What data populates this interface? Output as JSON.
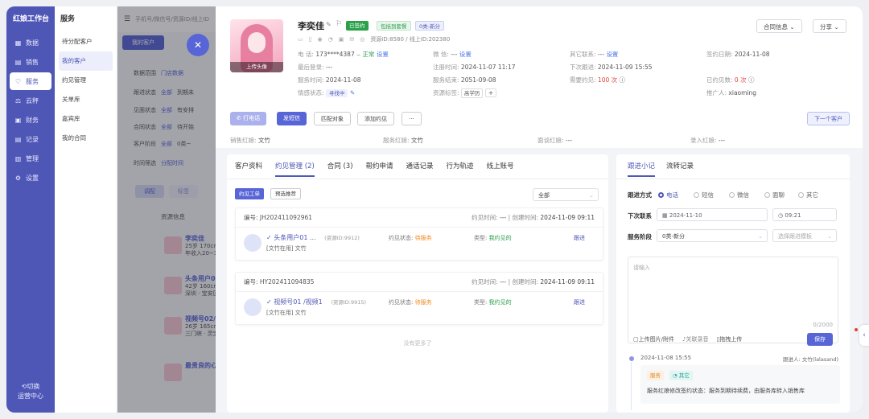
{
  "sidebar": {
    "brand": "红娘工作台",
    "items": [
      {
        "label": "数据",
        "icon": "grid-icon"
      },
      {
        "label": "销售",
        "icon": "chart-icon"
      },
      {
        "label": "服务",
        "icon": "heart-icon"
      },
      {
        "label": "云秤",
        "icon": "scale-icon"
      },
      {
        "label": "财务",
        "icon": "finance-icon"
      },
      {
        "label": "记录",
        "icon": "record-icon"
      },
      {
        "label": "管理",
        "icon": "manage-icon"
      },
      {
        "label": "设置",
        "icon": "gear-icon"
      }
    ],
    "active_index": 2,
    "switch_label": "切换",
    "ops_label": "运营中心"
  },
  "subnav": {
    "title": "服务",
    "items": [
      "待分配客户",
      "我的客户",
      "约见管理",
      "关单库",
      "嘉宾库",
      "我的合同"
    ],
    "active_index": 1
  },
  "background": {
    "search_placeholder": "手机号/微信号/资源ID/线上ID",
    "tab": "我的客户",
    "filter_rows": [
      {
        "label": "数据范围",
        "value": "门店数据"
      },
      {
        "label": "跟进状态",
        "value": "全部",
        "extra": "到期未"
      },
      {
        "label": "见面状态",
        "value": "全部",
        "extra": "有安排"
      },
      {
        "label": "合同状态",
        "value": "全部",
        "extra": "待开始"
      },
      {
        "label": "客户阶段",
        "value": "全部",
        "extra": "0类~"
      },
      {
        "label": "时间筛选",
        "value": "分配时间"
      }
    ],
    "btn_assign": "调配",
    "btn_mark": "标签",
    "list_header": "资源信息",
    "cards": [
      {
        "name": "李奕佳",
        "line1": "25岁 170cm",
        "line2": "年收入20~30万"
      },
      {
        "name": "头条用户03",
        "line1": "42岁 160cm",
        "line2": "深圳 · 宝安区"
      },
      {
        "name": "视频号02/视",
        "line1": "26岁 165cm",
        "line2": "三门峡 · 灵宝"
      },
      {
        "name": "最贵良的心",
        "line1": "",
        "line2": ""
      }
    ]
  },
  "profile": {
    "photo_label": "上传头像",
    "name": "李奕佳",
    "tags": [
      "已签约",
      "包括到套餐",
      "0类-新分"
    ],
    "resource_id": "资源ID:8580 / 线上ID:202380",
    "fields": {
      "phone_label": "电 话:",
      "phone": "173****4387",
      "phone_status": "正常",
      "phone_set": "设置",
      "wechat_label": "微 信:",
      "wechat": "---",
      "wechat_set": "设置",
      "other_label": "其它联系:",
      "other": "---",
      "other_set": "设置",
      "sign_label": "签约日期:",
      "sign_date": "2024-11-08",
      "login_label": "最后登录:",
      "login": "---",
      "reg_label": "注册时间:",
      "reg": "2024-11-07 11:17",
      "next_label": "下次跟进:",
      "next": "2024-11-09 15:55",
      "svc_time_label": "服务时间:",
      "svc_time": "2024-11-08",
      "svc_end_label": "服务结束:",
      "svc_end": "2051-09-08",
      "need_label": "需要约见:",
      "need": "100 次",
      "met_label": "已约见数:",
      "met": "0 次",
      "emo_label": "情感状态:",
      "emo": "寻找中",
      "res_tag_label": "资源标签:",
      "res_tag": "高学历",
      "ref_label": "推广人:",
      "ref": "xiaoming"
    },
    "contract_btn": "合同信息",
    "share_btn": "分享",
    "actions": [
      "打电话",
      "发短信",
      "匹配对象",
      "添加约见",
      "···"
    ],
    "next_customer": "下一个客户",
    "roles": [
      {
        "label": "销售红娘:",
        "value": "文竹"
      },
      {
        "label": "服务红娘:",
        "value": "文竹"
      },
      {
        "label": "面谈红娘:",
        "value": "---"
      },
      {
        "label": "录入红娘:",
        "value": "---"
      }
    ]
  },
  "left_pane": {
    "tabs": [
      "客户资料",
      "约见管理 (2)",
      "合同 (3)",
      "帮约申请",
      "通话记录",
      "行为轨迹",
      "线上账号"
    ],
    "active_tab": 1,
    "chip_active": "约见工单",
    "chip_other": "预选推荐",
    "filter_value": "全部",
    "records": [
      {
        "no": "编号: JH202411092961",
        "meet_label": "约见时间:",
        "meet": "---",
        "create_label": "创建时间:",
        "create": "2024-11-09 09:11",
        "name": "头条用户01 ...",
        "res_id": "(资源ID:9912)",
        "sub": "[文竹在用] 文竹",
        "state_label": "约见状态:",
        "state": "待服务",
        "type_label": "类型:",
        "type": "我约见的",
        "link": "跟进"
      },
      {
        "no": "编号: HY202411094835",
        "meet_label": "约见时间:",
        "meet": "---",
        "create_label": "创建时间:",
        "create": "2024-11-09 09:11",
        "name": "视频号01 /视频1",
        "res_id": "(资源ID:9915)",
        "sub": "[文竹在用] 文竹",
        "state_label": "约见状态:",
        "state": "待服务",
        "type_label": "类型:",
        "type": "我约见的",
        "link": "跟进"
      }
    ],
    "no_more": "没有更多了"
  },
  "right_pane": {
    "tabs": [
      "跟进小记",
      "流转记录"
    ],
    "active_tab": 0,
    "method_label": "跟进方式",
    "methods": [
      "电话",
      "短信",
      "微信",
      "面聊",
      "其它"
    ],
    "method_selected": 0,
    "next_label": "下次联系",
    "next_date": "2024-11-10",
    "next_time": "09:21",
    "stage_label": "服务阶段",
    "stage_value": "0类-新分",
    "template_placeholder": "选择跟进模板",
    "textarea_placeholder": "请输入",
    "counter": "0/2000",
    "tools": [
      "上传图片/附件",
      "关联录音",
      "拖拽上传"
    ],
    "save": "保存",
    "timeline": {
      "time": "2024-11-08 15:55",
      "by": "跟进人: 文竹(lalasand)",
      "tags": [
        "服务",
        "其它"
      ],
      "text": "服务红娘修改签约状态：服务到期待续费，由服务库转入销售库"
    }
  },
  "colors": {
    "primary": "#5865d6",
    "sidebar": "#4e56b6",
    "danger": "#e2403a",
    "warn": "#f28a20",
    "success": "#2b9b4b"
  }
}
